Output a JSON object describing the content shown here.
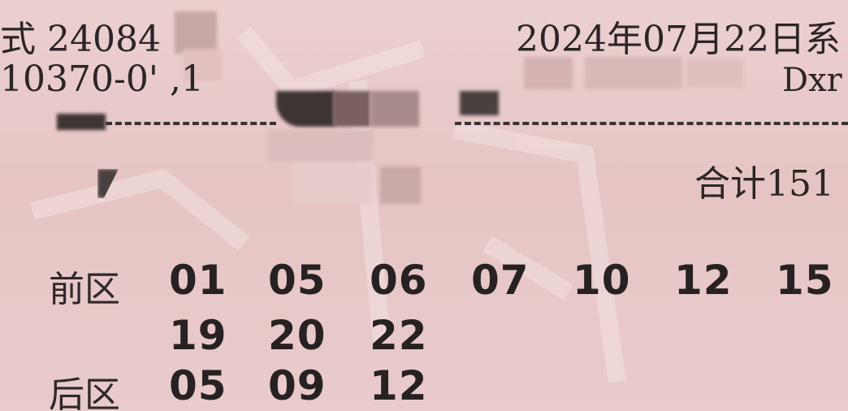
{
  "ticket": {
    "issue_text": "式 24084",
    "serial_text": "10370-0' ,1",
    "date_text": "2024年07月22日系",
    "code_text": "Dxr",
    "total_text": "合计151"
  },
  "front_zone": {
    "label": "前区",
    "numbers_row1": [
      "01",
      "05",
      "06",
      "07",
      "10",
      "12",
      "15"
    ],
    "numbers_row2": [
      "19",
      "20",
      "22"
    ]
  },
  "back_zone": {
    "label": "后区",
    "numbers": [
      "05",
      "09",
      "12"
    ]
  },
  "colors": {
    "paper": "#e8c8c8",
    "ink": "#2c2526"
  }
}
